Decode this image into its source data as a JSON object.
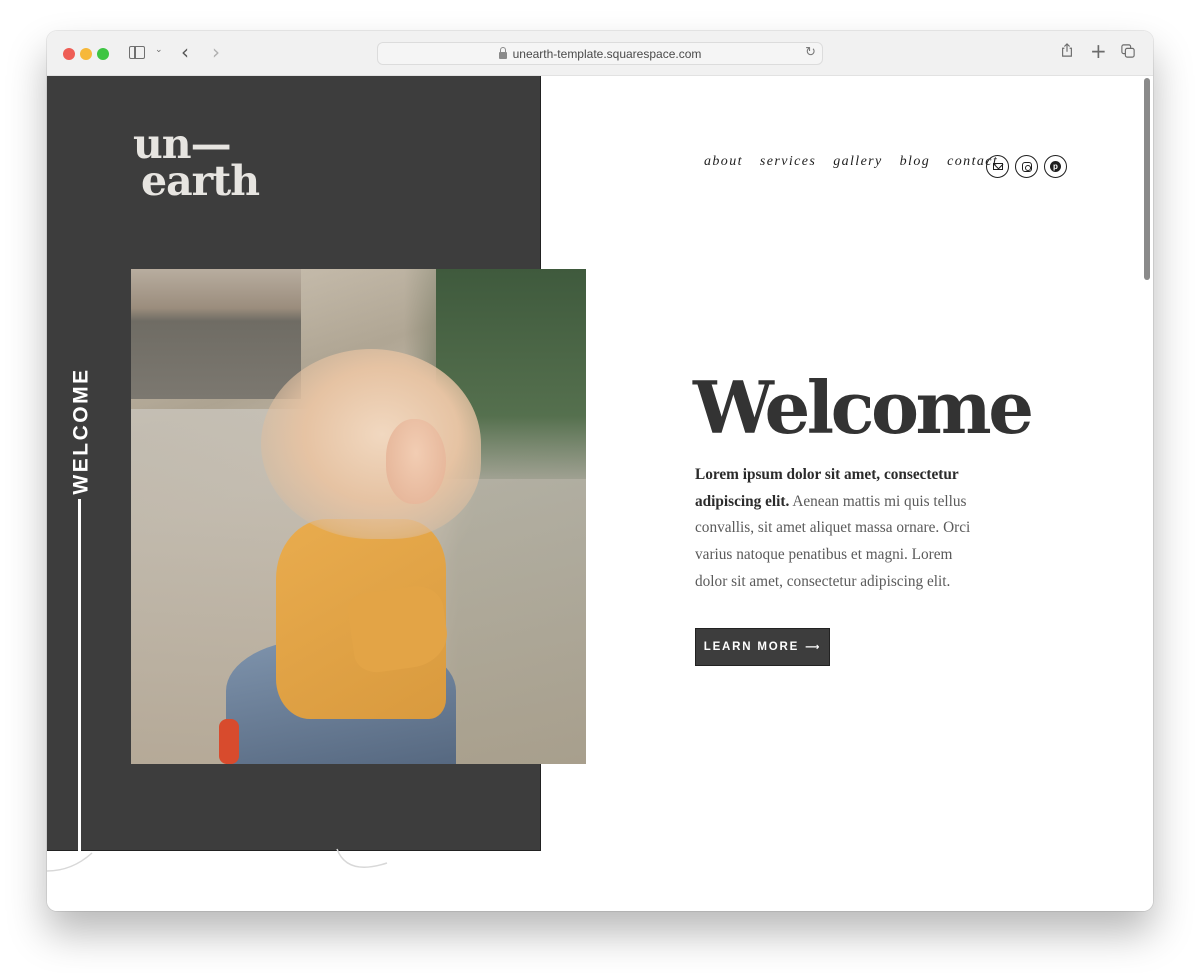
{
  "browser": {
    "url": "unearth-template.squarespace.com",
    "icons": {
      "sidebar": "sidebar-toggle-icon",
      "back": "chevron-left-icon",
      "forward": "chevron-right-icon",
      "share": "share-icon",
      "new_tab": "plus-icon",
      "tabs": "tab-overview-icon",
      "reload": "reload-icon",
      "lock": "lock-icon"
    },
    "glyphs": {
      "chevron_down": "⌄",
      "back": "‹",
      "forward": "›",
      "reload": "↻",
      "plus": "+"
    }
  },
  "site": {
    "logo_line1": "un—",
    "logo_line2": "earth",
    "side_label": "WELCOME",
    "nav": [
      {
        "label": "about"
      },
      {
        "label": "services"
      },
      {
        "label": "gallery"
      },
      {
        "label": "blog"
      },
      {
        "label": "contact"
      }
    ],
    "social": [
      {
        "name": "email",
        "icon": "mail-icon"
      },
      {
        "name": "instagram",
        "icon": "instagram-icon"
      },
      {
        "name": "pinterest",
        "icon": "pinterest-icon",
        "glyph": "p"
      }
    ],
    "hero": {
      "title": "Welcome",
      "body_bold": "Lorem ipsum dolor sit amet, consectetur adipiscing elit.",
      "body_rest": " Aenean mattis mi quis tellus convallis, sit amet aliquet massa ornare. Orci varius natoque penatibus et magni. Lorem dolor sit amet, consectetur adipiscing elit.",
      "cta_label": "LEARN MORE",
      "cta_arrow": "⟶"
    },
    "photo_alt": "Smiling woman with blonde hair in a yellow t-shirt and denim jacket on a dirt road"
  },
  "colors": {
    "panel": "#3d3d3d",
    "text_dark": "#333333",
    "text_body": "#5a5a5a",
    "button_bg": "#3d3d3d",
    "logo": "#e7e5e1"
  }
}
